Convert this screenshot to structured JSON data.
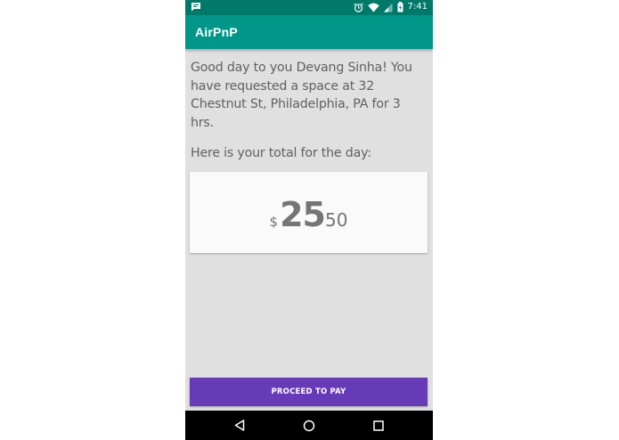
{
  "status_bar": {
    "time": "7:41",
    "battery_level": "charging",
    "icons": [
      "message-icon",
      "alarm-icon",
      "wifi-icon",
      "signal-icon",
      "battery-charging-icon"
    ]
  },
  "app_bar": {
    "title": "AirPnP"
  },
  "main": {
    "greeting": "Good day to you Devang Sinha! You have requested a space at 32 Chestnut St, Philadelphia, PA for 3 hrs.",
    "total_label": "Here is your total for the day:",
    "price": {
      "currency": "$",
      "dollars": "25",
      "cents": "50"
    }
  },
  "actions": {
    "proceed_label": "PROCEED TO PAY"
  },
  "nav_bar": {
    "buttons": [
      "back-icon",
      "home-icon",
      "recents-icon"
    ]
  },
  "colors": {
    "status_bar": "#00796b",
    "app_bar": "#009688",
    "background": "#e0e0e0",
    "card": "#fafafa",
    "button": "#673ab7",
    "text": "#616161"
  }
}
